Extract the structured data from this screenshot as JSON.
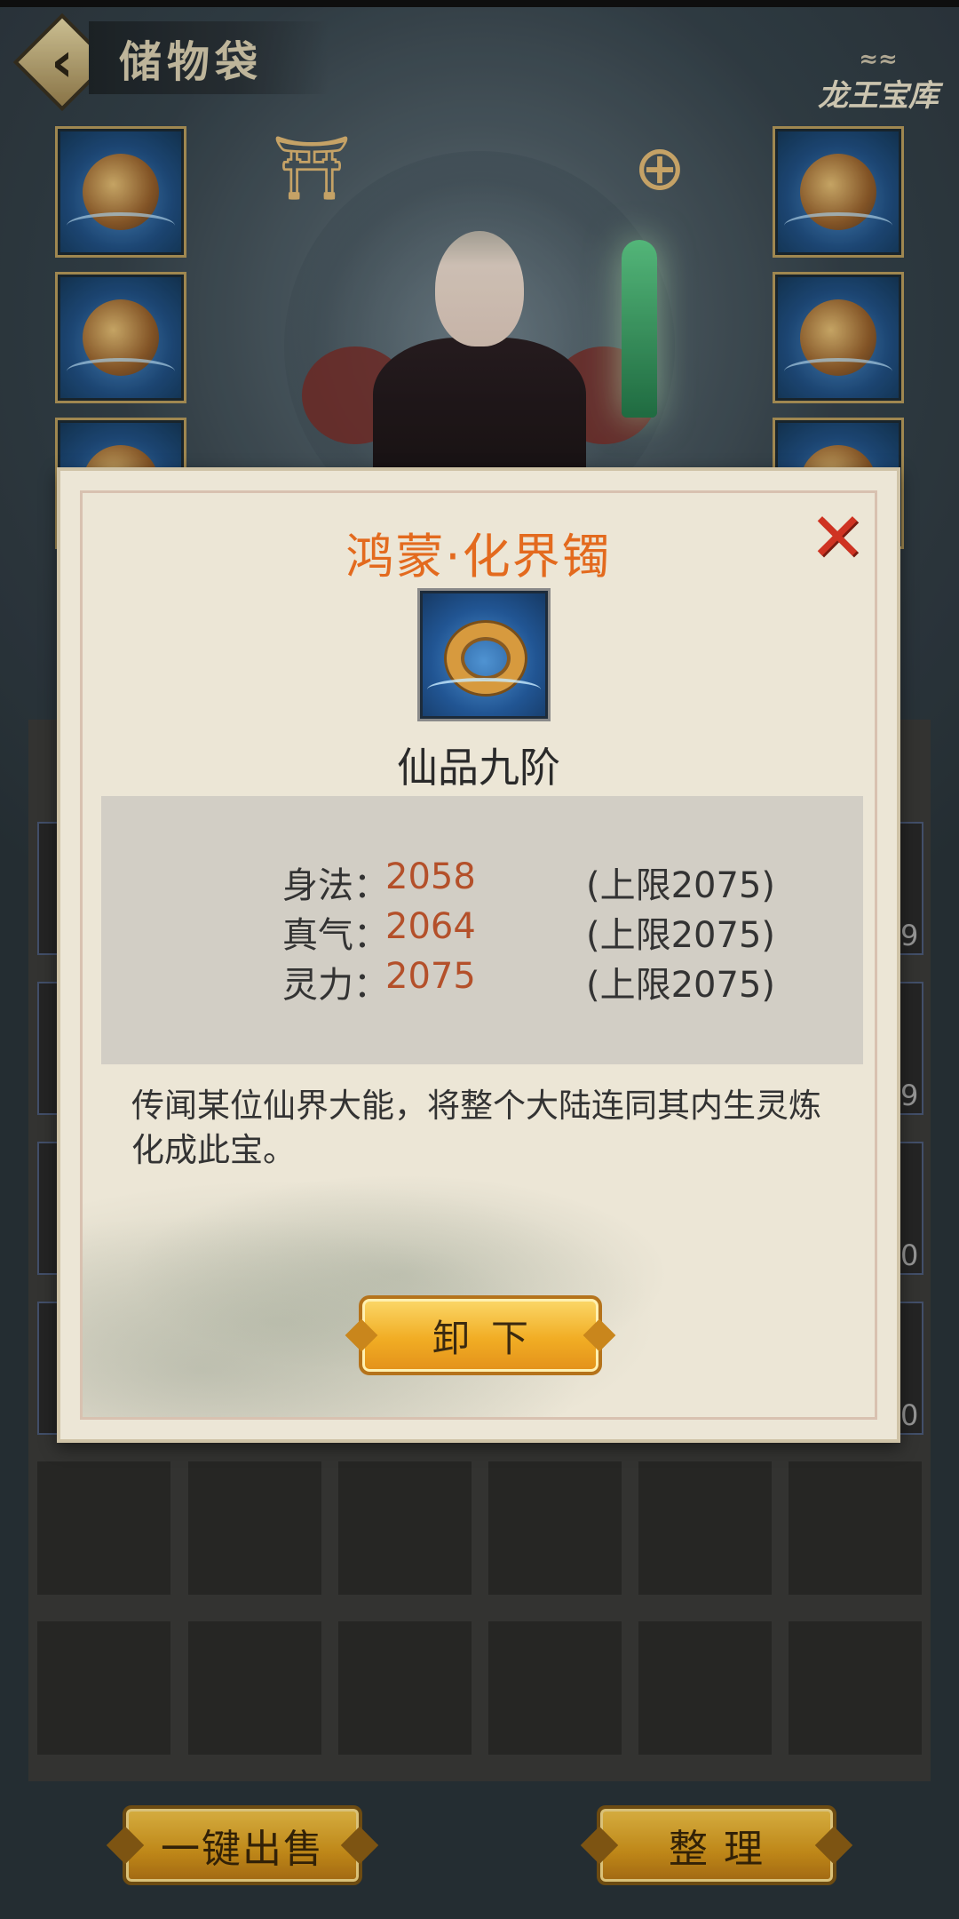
{
  "header": {
    "title": "储物袋",
    "treasury_label": "龙王宝库"
  },
  "equipment": {
    "left_slots": [
      "weapon",
      "helmet",
      "armor"
    ],
    "right_slots": [
      "ring",
      "pendant",
      "bracelet"
    ]
  },
  "dialog": {
    "item_name": "鸿蒙·化界镯",
    "grade": "仙品九阶",
    "stats": [
      {
        "label": "身法：",
        "value": "2058",
        "cap": "(上限2075)"
      },
      {
        "label": "真气：",
        "value": "2064",
        "cap": "(上限2075)"
      },
      {
        "label": "灵力：",
        "value": "2075",
        "cap": "(上限2075)"
      }
    ],
    "description": "传闻某位仙界大能，将整个大陆连同其内生灵炼化成此宝。",
    "unequip_label": "卸下"
  },
  "footer": {
    "sell_all_label": "一键出售",
    "sort_label": "整 理"
  },
  "side_counts": [
    "9",
    "9",
    "0",
    "0"
  ],
  "colors": {
    "item_name": "#e36a1e",
    "stat_value": "#b4502a",
    "close": "#cf3322",
    "button_gold": "#f1ad24"
  }
}
